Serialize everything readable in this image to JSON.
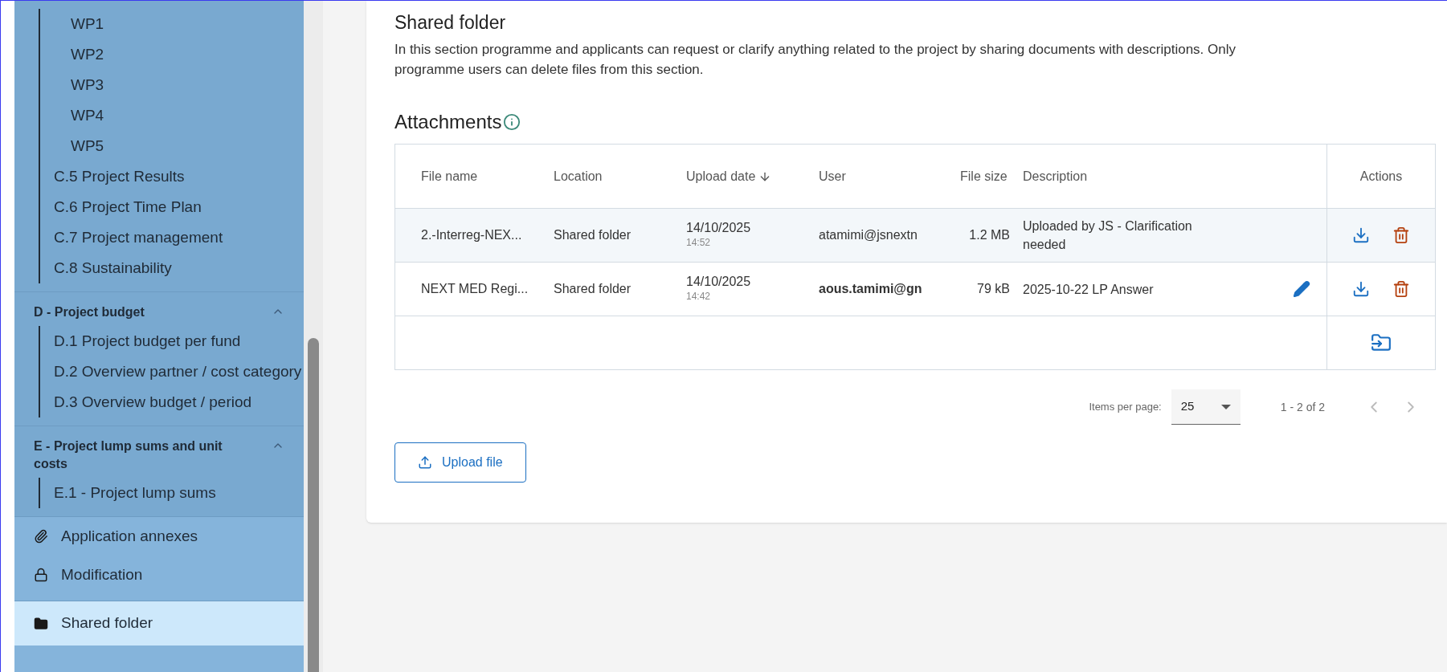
{
  "sidebar": {
    "groups": [
      {
        "items": [
          {
            "children": [
              {
                "label": "WP1"
              },
              {
                "label": "WP2"
              },
              {
                "label": "WP3"
              },
              {
                "label": "WP4"
              },
              {
                "label": "WP5"
              }
            ]
          },
          {
            "label": "C.5 Project Results"
          },
          {
            "label": "C.6 Project Time Plan"
          },
          {
            "label": "C.7 Project management"
          },
          {
            "label": "C.8 Sustainability"
          }
        ]
      },
      {
        "title": "D - Project budget",
        "expanded": true,
        "items": [
          {
            "label": "D.1 Project budget per fund"
          },
          {
            "label": "D.2 Overview partner / cost category"
          },
          {
            "label": "D.3 Overview budget / period"
          }
        ]
      },
      {
        "title": "E - Project lump sums and unit costs",
        "expanded": true,
        "items": [
          {
            "label": "E.1 - Project lump sums"
          }
        ]
      }
    ],
    "nav": [
      {
        "label": "Application annexes",
        "selected": false
      },
      {
        "label": "Modification",
        "selected": false
      },
      {
        "label": "Shared folder",
        "selected": true
      }
    ]
  },
  "main": {
    "title": "Shared folder",
    "description": "In this section programme and applicants can request or clarify anything related to the project by sharing documents with descriptions. Only programme users can delete files from this section.",
    "attachments": {
      "title": "Attachments",
      "columns": [
        {
          "label": "File name",
          "sorted": false
        },
        {
          "label": "Location",
          "sorted": false
        },
        {
          "label": "Upload date",
          "sorted": true
        },
        {
          "label": "User",
          "sorted": false
        },
        {
          "label": "File size",
          "sorted": false
        },
        {
          "label": "Description",
          "sorted": false
        },
        {
          "label": "Actions",
          "sorted": false
        }
      ],
      "rows": [
        {
          "file_name": "2.-Interreg-NEX...",
          "location": "Shared folder",
          "date": "14/10/2025",
          "time": "14:52",
          "user": "atamimi@jsnextn",
          "current_user": false,
          "size": "1.2 MB",
          "description": "Uploaded by JS - Clarification needed",
          "editable": false,
          "highlighted": true
        },
        {
          "file_name": "NEXT MED Regi...",
          "location": "Shared folder",
          "date": "14/10/2025",
          "time": "14:42",
          "user": "aous.tamimi@gn",
          "current_user": true,
          "size": "79 kB",
          "description": "2025-10-22 LP Answer",
          "editable": true,
          "highlighted": false
        }
      ],
      "pagination": {
        "label": "Items per page:",
        "page_size": "25",
        "range": "1 - 2 of 2"
      },
      "upload_button": "Upload file"
    }
  }
}
